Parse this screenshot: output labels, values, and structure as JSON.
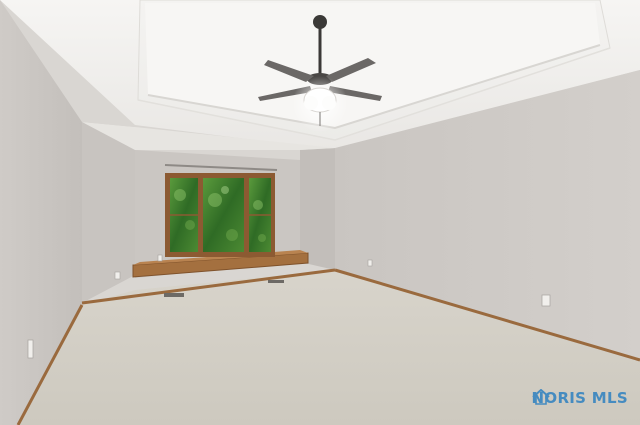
{
  "watermark": {
    "text": "NORIS MLS",
    "color": "#3a86c0"
  },
  "colors": {
    "ceiling": "#f2f1ef",
    "wall_light": "#cfcbc7",
    "wall_shadow": "#bdb8b4",
    "carpet": "#d4d0c6",
    "trim": "#9a6a3e",
    "window_frame": "#8c5a32",
    "foliage": "#3f7a2e"
  }
}
